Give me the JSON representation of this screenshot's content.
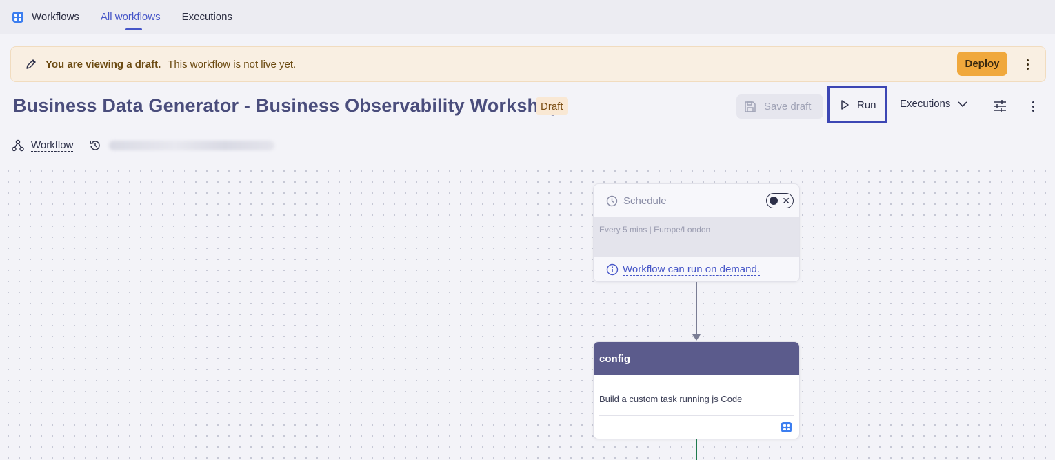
{
  "topnav": {
    "app_name": "Workflows",
    "tabs": [
      {
        "label": "All workflows",
        "active": true
      },
      {
        "label": "Executions",
        "active": false
      }
    ]
  },
  "banner": {
    "strong": "You are viewing a draft.",
    "text": "This workflow is not live yet.",
    "deploy_label": "Deploy"
  },
  "header": {
    "title": "Business Data Generator - Business Observability Workshop",
    "badge": "Draft",
    "save_label": "Save draft",
    "run_label": "Run",
    "executions_label": "Executions"
  },
  "subbar": {
    "workflow_label": "Workflow"
  },
  "nodes": {
    "schedule": {
      "title": "Schedule",
      "detail": "Every 5 mins | Europe/London",
      "on_demand": "Workflow can run on demand."
    },
    "config": {
      "title": "config",
      "description": "Build a custom task running js Code"
    }
  },
  "colors": {
    "accent": "#4656c8",
    "deploy": "#f0a83c",
    "node_header": "#5b5b8c",
    "run_highlight": "#3c46b4"
  }
}
